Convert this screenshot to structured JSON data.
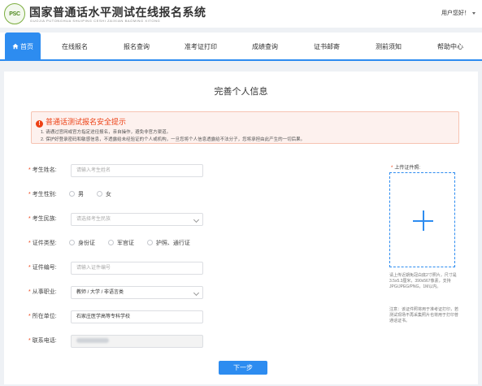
{
  "header": {
    "logo_text": "PSC",
    "title": "国家普通话水平测试在线报名系统",
    "subtitle": "GUOJIA PUTONGHUA SHUIPING CESHI ZAIXIAN BAOMING XITONG",
    "greeting": "用户您好！"
  },
  "nav": {
    "items": [
      {
        "label": "首页",
        "icon": "home-icon",
        "active": true
      },
      {
        "label": "在线报名"
      },
      {
        "label": "报名查询"
      },
      {
        "label": "准考证打印"
      },
      {
        "label": "成绩查询"
      },
      {
        "label": "证书邮寄"
      },
      {
        "label": "测前须知"
      },
      {
        "label": "帮助中心"
      }
    ],
    "accent_color": "#2d8cf0"
  },
  "page": {
    "title": "完善个人信息"
  },
  "alert": {
    "title": "普通话测试报名安全提示",
    "lines": [
      "1. 请通过官网或官方指定途径报名，亲自操作，避免非官方渠道。",
      "2. 保护好登录密码和敏感信息，不透露给未经验证的个人或机构，一旦您将个人信息透露给不法分子，您将承担由此产生的一切后果。"
    ],
    "color": "#ed4014"
  },
  "form": {
    "name": {
      "label": "考生姓名:",
      "placeholder": "请输入考生姓名"
    },
    "gender": {
      "label": "考生性别:",
      "options": [
        "男",
        "女"
      ]
    },
    "ethnicity": {
      "label": "考生民族:",
      "placeholder": "请选择考生民族"
    },
    "id_type": {
      "label": "证件类型:",
      "options": [
        "身份证",
        "军官证",
        "护照、通行证"
      ]
    },
    "id_number": {
      "label": "证件编号:",
      "placeholder": "请输入证件编号"
    },
    "occupation": {
      "label": "从事职业:",
      "value": "教师 / 大学 / 非语言类"
    },
    "work_unit": {
      "label": "所在单位:",
      "value": "石家庄医学高等专科学校"
    },
    "phone": {
      "label": "联系电话:"
    }
  },
  "upload": {
    "label": "上传证件照:",
    "note1": "请上传近期免冠白底2寸照片，尺寸是3.5x5.3厘米，390x567像素，支持JPG/JPEG/PNG，1M以内。",
    "note2": "注意：该证件照将用于准考证打印，若测试现场不再采集照片也将用于打印普通话证书。"
  },
  "next_button": "下一步"
}
